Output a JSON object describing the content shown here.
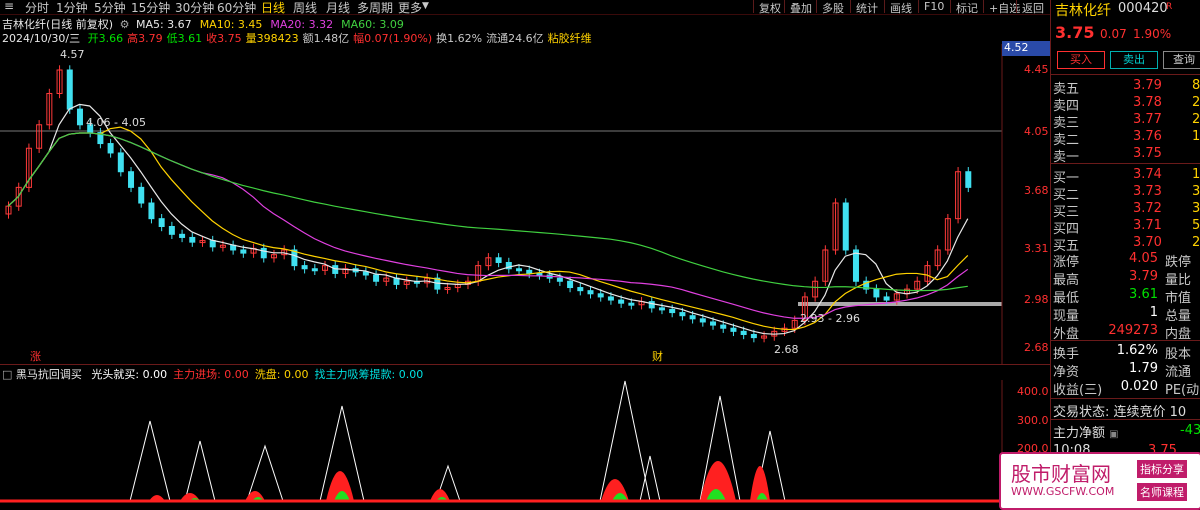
{
  "toolbar": {
    "periods": [
      "分时",
      "1分钟",
      "5分钟",
      "15分钟",
      "30分钟",
      "60分钟",
      "日线",
      "周线",
      "月线",
      "多周期",
      "更多"
    ],
    "active_period": "日线",
    "buttons": [
      "复权",
      "叠加",
      "多股",
      "统计",
      "画线",
      "F10",
      "标记",
      "+自选",
      "返回"
    ]
  },
  "header": {
    "stock_title": "吉林化纤(日线 前复权)",
    "ma_labels": [
      {
        "text": "MA5: 3.67",
        "color": "#e8e8e8"
      },
      {
        "text": "MA10: 3.45",
        "color": "#ffd200"
      },
      {
        "text": "MA20: 3.32",
        "color": "#e040e0"
      },
      {
        "text": "MA60: 3.09",
        "color": "#40d040"
      }
    ],
    "date": "2024/10/30/三",
    "ohlc": [
      {
        "text": "开3.66",
        "color": "#00e000"
      },
      {
        "text": "高3.79",
        "color": "#ff3030"
      },
      {
        "text": "低3.61",
        "color": "#00e000"
      },
      {
        "text": "收3.75",
        "color": "#ff3030"
      },
      {
        "text": "量398423",
        "color": "#ffd200"
      },
      {
        "text": "额1.48亿",
        "color": "#c8c8c8"
      },
      {
        "text": "幅0.07(1.90%)",
        "color": "#ff3030"
      },
      {
        "text": "换1.62%",
        "color": "#c8c8c8"
      },
      {
        "text": "流通24.6亿",
        "color": "#c8c8c8"
      },
      {
        "text": "粘胶纤维",
        "color": "#ffd200"
      }
    ]
  },
  "price_axis": [
    "4.45",
    "4.05",
    "3.68",
    "3.31",
    "2.98",
    "2.68"
  ],
  "price_tag": "4.52",
  "annotations": {
    "high": "4.57",
    "level_top": "4.06 - 4.05",
    "level_bottom": "2.93 - 2.96",
    "low": "2.68",
    "event1": "涨",
    "event2": "财"
  },
  "indicator": {
    "title": "黑马抗回调买",
    "items": [
      {
        "text": "光头就买: 0.00",
        "color": "#ffffff"
      },
      {
        "text": "主力进场: 0.00",
        "color": "#ff3030"
      },
      {
        "text": "洗盘: 0.00",
        "color": "#ffd200"
      },
      {
        "text": "找主力吸筹提款: 0.00",
        "color": "#00e0e0"
      }
    ],
    "axis": [
      "400.0",
      "300.0",
      "200.0"
    ]
  },
  "quote": {
    "name": "吉林化纤",
    "code": "000420",
    "badge": "R",
    "price": "3.75",
    "change": "0.07",
    "pct": "1.90%",
    "buy_btn": "买入",
    "sell_btn": "卖出",
    "query_btn": "查询",
    "asks": [
      {
        "label": "卖五",
        "price": "3.79",
        "vol": "8"
      },
      {
        "label": "卖四",
        "price": "3.78",
        "vol": "2"
      },
      {
        "label": "卖三",
        "price": "3.77",
        "vol": "2"
      },
      {
        "label": "卖二",
        "price": "3.76",
        "vol": "1"
      },
      {
        "label": "卖一",
        "price": "3.75",
        "vol": ""
      }
    ],
    "bids": [
      {
        "label": "买一",
        "price": "3.74",
        "vol": "1"
      },
      {
        "label": "买二",
        "price": "3.73",
        "vol": "3"
      },
      {
        "label": "买三",
        "price": "3.72",
        "vol": "3"
      },
      {
        "label": "买四",
        "price": "3.71",
        "vol": "5"
      },
      {
        "label": "买五",
        "price": "3.70",
        "vol": "2"
      }
    ],
    "stats": [
      {
        "l1": "涨停",
        "v1": "4.05",
        "c1": "red",
        "l2": "跌停"
      },
      {
        "l1": "最高",
        "v1": "3.79",
        "c1": "red",
        "l2": "量比"
      },
      {
        "l1": "最低",
        "v1": "3.61",
        "c1": "green",
        "l2": "市值"
      },
      {
        "l1": "现量",
        "v1": "1",
        "c1": "white",
        "l2": "总量"
      },
      {
        "l1": "外盘",
        "v1": "249273",
        "c1": "red",
        "l2": "内盘"
      }
    ],
    "stats2": [
      {
        "l1": "换手",
        "v1": "1.62%",
        "l2": "股本"
      },
      {
        "l1": "净资",
        "v1": "1.79",
        "l2": "流通"
      },
      {
        "l1": "收益(三)",
        "v1": "0.020",
        "l2": "PE(动"
      }
    ],
    "trade_state": "交易状态: 连续竞价 10",
    "main_flow_label": "主力净额",
    "main_flow_value": "-43",
    "tick_time": "10:08",
    "tick_price": "3.75"
  },
  "ad": {
    "title": "股市财富网",
    "url": "WWW.GSCFW.COM",
    "tag1": "指标分享",
    "tag2": "名师课程"
  }
}
